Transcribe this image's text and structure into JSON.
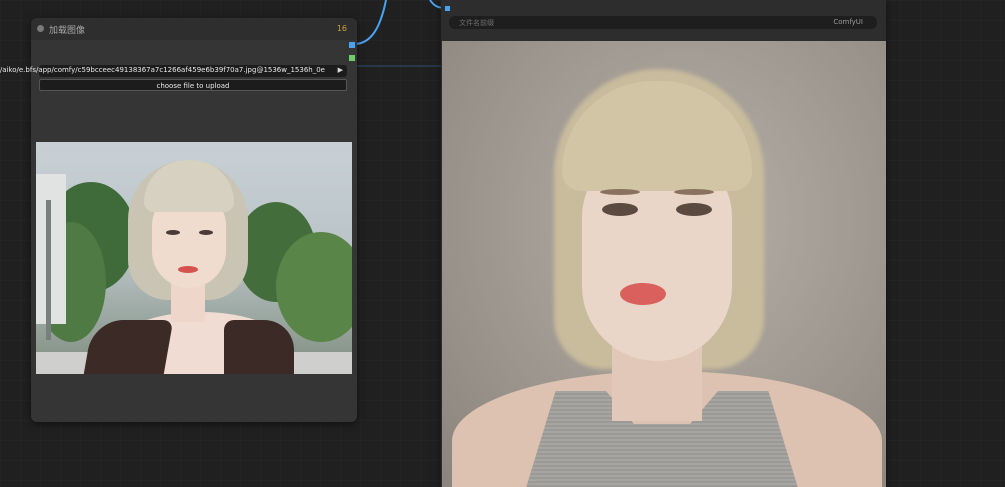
{
  "load_node": {
    "title": "加载图像",
    "node_id": "16",
    "image_url": ".com/bfs/aiko/e.bfs/app/comfy/c59bcceec49138367a7c1266af459e6b39f70a7.jpg@1536w_1536h_0e",
    "upload_label": "choose file to upload"
  },
  "preview_node": {
    "filename_placeholder": "文件名前缀",
    "filename_value": "ComfyUI"
  },
  "colors": {
    "canvas_bg": "#202020",
    "node_bg": "#353535",
    "wire_image": "#4aa3f0",
    "port_mask": "#6ccf6c",
    "node_id": "#c9a33a"
  },
  "icons": {
    "upload_arrow": "triangle-right-icon",
    "title_dot": "circle-icon",
    "node_badge": "badge-icon"
  }
}
